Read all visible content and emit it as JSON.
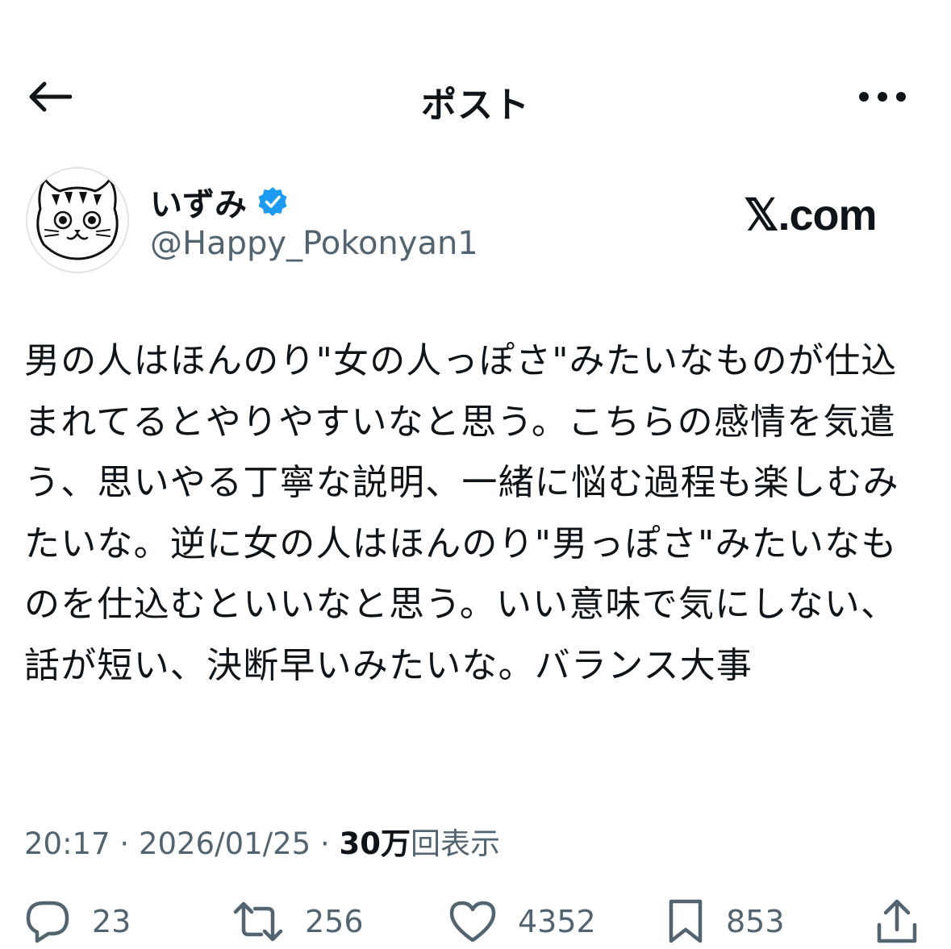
{
  "header": {
    "title": "ポスト",
    "back_icon": "arrow-left-icon",
    "more_icon": "more-horizontal-icon"
  },
  "author": {
    "display_name": "いずみ",
    "handle": "@Happy_Pokonyan1",
    "verified": true,
    "verified_color": "#1d9bf0"
  },
  "brand": {
    "text": "𝕏.com"
  },
  "tweet": {
    "text": "男の人はほんのり\"女の人っぽさ\"みたいなものが仕込まれてるとやりやすいなと思う。こちらの感情を気遣う、思いやる丁寧な説明、一緒に悩む過程も楽しむみたいな。逆に女の人はほんのり\"男っぽさ\"みたいなものを仕込むといいなと思う。いい意味で気にしない、話が短い、決断早いみたいな。バランス大事"
  },
  "meta": {
    "time": "20:17",
    "separator": "·",
    "date": "2026/01/25",
    "views_count": "30万",
    "views_label": "回表示"
  },
  "actions": {
    "replies": "23",
    "reposts": "256",
    "likes": "4352",
    "bookmarks": "853"
  },
  "colors": {
    "text": "#0f1419",
    "secondary": "#536471",
    "accent": "#1d9bf0",
    "background": "#ffffff"
  }
}
